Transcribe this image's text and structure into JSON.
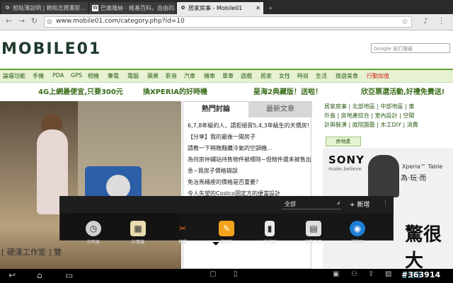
{
  "tabs": [
    {
      "title": "剪貼薄說明 | 賴和志霞書影...",
      "favicon": "✿"
    },
    {
      "title": "巴塞隆納 - 維基百科，自由的...",
      "favicon": "W"
    },
    {
      "title": "居家房事 - Mobile01",
      "favicon": "✿",
      "active": true
    }
  ],
  "url": "www.mobile01.com/category.php?id=10",
  "page": {
    "logo": "MOBILE01",
    "search_placeholder": "Google 自訂搜尋",
    "categories": [
      "論壇功能",
      "手機",
      "PDA",
      "GPS",
      "相機",
      "筆電",
      "電腦",
      "蘋果",
      "影音",
      "汽車",
      "機車",
      "單車",
      "遊戲",
      "居家",
      "女性",
      "時尚",
      "生活",
      "旅遊美食",
      "行動加值"
    ],
    "promos": [
      "4G上網最便宜,只要300元",
      "換XPERIA的好時機",
      "星海2典藏版！送啦！",
      "欣亞票選活動,好禮免費送!"
    ],
    "photo_caption": "[ 硬漢工作室 ] 雙",
    "hot_tab": "熱門討論",
    "latest_tab": "最新文章",
    "hot_list": [
      "6,7,8年級的人，請拒絕買5,4,3年級生的天價房!",
      "【分享】我的最後一間房子",
      "請教一下稍微麵攤冷氣的空調機...",
      "為何房仲鋪站待售物件被標除~但物件還未被售出??",
      "急~買房子價格錯誤",
      "免治馬桶座的價格是否重要？",
      "令人失望的Costco固定方的便當設計"
    ],
    "right_links": [
      "居家房事 | 北部地區 | 中部地區 | 東",
      "外島 | 房地產綜合 | 室內設計 | 空間",
      "計與裝潢 | 庭院園藝 | 木工DIY | 消費"
    ],
    "house_button": "房地產",
    "ad": {
      "brand": "SONY",
      "tagline": "make.believe",
      "product": "Xperia™ Table",
      "slogan": "為·玩·而",
      "headline": "驚很大"
    }
  },
  "launcher": {
    "filter": "全部",
    "add_label": "+ 新增",
    "menu_glyph": "⋮",
    "apps": [
      {
        "label": "計時器",
        "icon": "timer-icon",
        "color": "#cfcfcf"
      },
      {
        "label": "計算機",
        "icon": "calculator-icon",
        "color": "#e8dcb0"
      },
      {
        "label": "剪輯",
        "icon": "scissors-icon",
        "color": "#e26d25"
      },
      {
        "label": "備忘錄",
        "icon": "memo-icon",
        "color": "#f3a21c"
      },
      {
        "label": "遙控器",
        "icon": "remote-icon",
        "color": "#e9e9e9"
      },
      {
        "label": "錄製工具",
        "icon": "recorder-icon",
        "color": "#dedede"
      },
      {
        "label": "瀏覽器",
        "icon": "browser-icon",
        "color": "#1f7fd6"
      }
    ]
  },
  "sysbar": {
    "clock": "1:36",
    "watermark": "#363914"
  }
}
